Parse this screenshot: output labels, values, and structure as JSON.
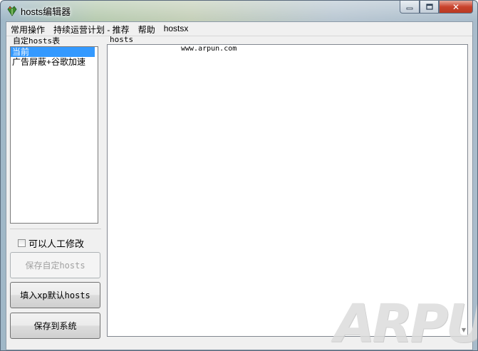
{
  "window": {
    "title": "hosts编辑器"
  },
  "menu": [
    {
      "label": "常用操作"
    },
    {
      "label": "持续运营计划 - 推荐"
    },
    {
      "label": "帮助"
    },
    {
      "label": "hostsx"
    }
  ],
  "left_panel": {
    "group_label": "自定hosts表",
    "list_items": [
      {
        "label": "当前",
        "selected": true
      },
      {
        "label": "广告屏蔽+谷歌加速",
        "selected": false
      }
    ],
    "checkbox_label": "可以人工修改",
    "checkbox_checked": false,
    "save_custom_label": "保存自定hosts",
    "fill_default_label": "填入xp默认hosts",
    "save_system_label": "保存到系统"
  },
  "editor": {
    "label": "hosts",
    "content": "www.arpun.com"
  },
  "watermark": "ARPUN",
  "colors": {
    "selection": "#3399ff",
    "close_button": "#c8422c"
  }
}
